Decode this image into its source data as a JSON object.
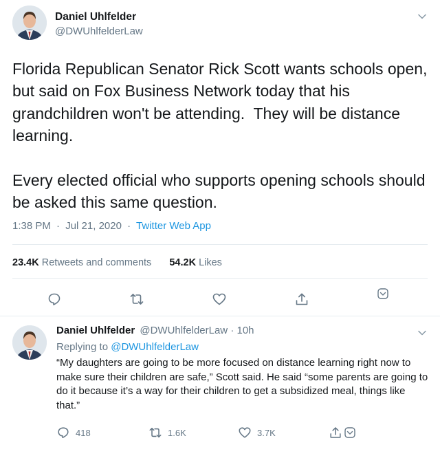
{
  "tweet": {
    "author_name": "Daniel Uhlfelder",
    "author_handle": "@DWUhlfelderLaw",
    "text": "Florida Republican Senator Rick Scott wants schools open, but said on Fox Business Network today that his grandchildren won't be attending.  They will be distance learning.\n\nEvery elected official who supports opening schools should be asked this same question.",
    "time": "1:38 PM",
    "date": "Jul 21, 2020",
    "separator": "·",
    "source": "Twitter Web App",
    "retweets_count": "23.4K",
    "retweets_label": "Retweets and comments",
    "likes_count": "54.2K",
    "likes_label": "Likes",
    "actions": {
      "reply_icon": "comment-icon",
      "retweet_icon": "retweet-icon",
      "like_icon": "heart-icon",
      "share_icon": "share-icon",
      "more_icon": "chevron-down-icon"
    }
  },
  "reply": {
    "author_name": "Daniel Uhlfelder",
    "author_handle": "@DWUhlfelderLaw",
    "separator": "·",
    "time": "10h",
    "replying_prefix": "Replying to",
    "replying_to": "@DWUhlfelderLaw",
    "text": "“My daughters are going to be more focused on distance learning right now to make sure their children are safe,” Scott said. He said “some parents are going to do it because it’s a way for their children to get a subsidized meal, things like that.”",
    "reply_count": "418",
    "retweet_count": "1.6K",
    "like_count": "3.7K"
  },
  "colors": {
    "text_primary": "#14171a",
    "text_secondary": "#657786",
    "link": "#1b95e0",
    "divider": "#e6ecf0"
  }
}
